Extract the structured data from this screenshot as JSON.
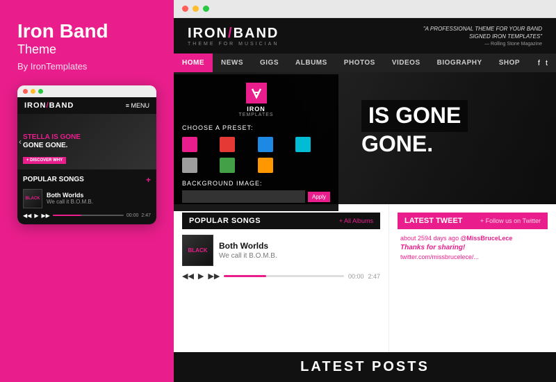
{
  "left": {
    "brand": {
      "title": "Iron Band",
      "subtitle": "Theme",
      "author": "By IronTemplates"
    },
    "mobile_preview": {
      "dots": [
        "red",
        "yellow",
        "green"
      ],
      "logo": "IRON/BAND",
      "menu_label": "≡ MENU",
      "hero_text_line1": "STELLA IS GONE",
      "hero_text_line2": "GONE GONE.",
      "discover_btn": "+ DISCOVER WHY",
      "popular_songs_title": "POPULAR SONGS",
      "add_icon": "+",
      "song": {
        "thumb_label": "BLACK",
        "title": "Both Worlds",
        "artist": "We call it B.O.M.B.",
        "time_current": "00:00",
        "time_total": "2:47"
      }
    }
  },
  "right": {
    "browser_dots": [
      "red",
      "yellow",
      "green"
    ],
    "site": {
      "logo_main": "IRON/BAND",
      "logo_tagline": "THEME FOR MUSICIAN",
      "header_quote": "\"A PROFESSIONAL THEME FOR YOUR BAND SIGNED IRON TEMPLATES\"",
      "header_quote_source": "— Rolling Stone Magazine",
      "nav_items": [
        {
          "label": "HOME",
          "active": true
        },
        {
          "label": "NEWS",
          "active": false
        },
        {
          "label": "GIGS",
          "active": false
        },
        {
          "label": "ALBUMS",
          "active": false
        },
        {
          "label": "PHOTOS",
          "active": false
        },
        {
          "label": "VIDEOS",
          "active": false
        },
        {
          "label": "BIOGRAPHY",
          "active": false
        },
        {
          "label": "SHOP",
          "active": false
        }
      ],
      "nav_social": [
        "f",
        "t"
      ],
      "preset_panel": {
        "choose_preset_label": "CHOOSE A PRESET:",
        "colors_row1": [
          "#e91e8c",
          "#e53935",
          "#1e88e5",
          "#00bcd4"
        ],
        "colors_row2": [
          "#9e9e9e",
          "#43a047",
          "#ff9800"
        ],
        "bg_image_label": "BACKGROUND IMAGE:",
        "apply_btn": "Apply",
        "iron_panel_label": "IRON",
        "iron_panel_sublabel": "TEMPLATES"
      },
      "hero": {
        "text_line1": "IS GONE",
        "text_line2": "GONE."
      },
      "popular_songs": {
        "title": "POPULAR SONGS",
        "all_albums_link": "+ All Albums",
        "song": {
          "thumb_label": "BLACK",
          "title": "Both Worlds",
          "artist": "We call it B.O.M.B.",
          "time_current": "00:00",
          "time_total": "2:47"
        }
      },
      "latest_tweet": {
        "title": "LATEST TWEET",
        "follow_link": "+ Follow us on Twitter",
        "time": "about 2594 days ago",
        "handle": "@MissBruceLece",
        "text": "Thanks for sharing!",
        "link": "twitter.com/missbrucelece/..."
      },
      "latest_posts_bar": "LATEST POSTS"
    }
  }
}
